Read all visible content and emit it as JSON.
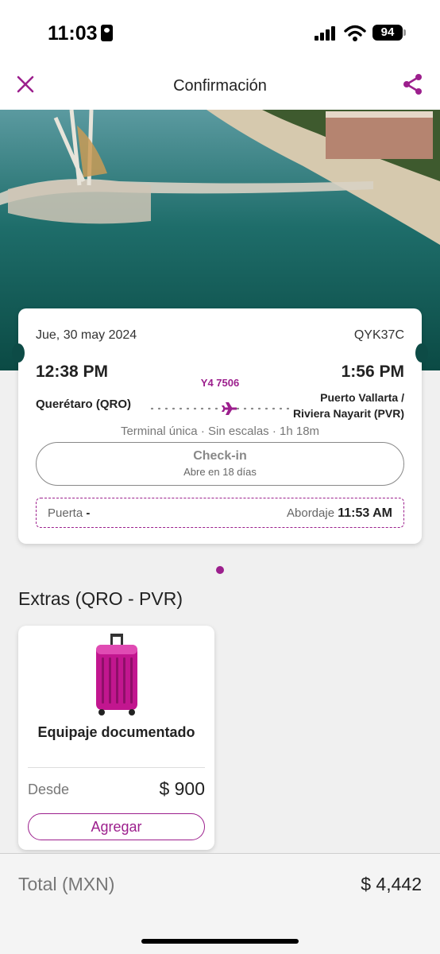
{
  "status_bar": {
    "time": "11:03",
    "battery": "94"
  },
  "header": {
    "title": "Confirmación"
  },
  "flight": {
    "date": "Jue, 30 may 2024",
    "booking_code": "QYK37C",
    "departure_time": "12:38 PM",
    "arrival_time": "1:56 PM",
    "flight_number": "Y4 7506",
    "origin": "Querétaro (QRO)",
    "destination_line1": "Puerto Vallarta /",
    "destination_line2": "Riviera Nayarit (PVR)",
    "meta": "Terminal única · Sin escalas · 1h 18m",
    "checkin_label": "Check-in",
    "checkin_sub": "Abre en 18 días",
    "gate_label": "Puerta",
    "gate_value": "-",
    "boarding_label": "Abordaje",
    "boarding_time": "11:53 AM"
  },
  "extras": {
    "title": "Extras (QRO - PVR)",
    "items": [
      {
        "name": "Equipaje documentado",
        "from_label": "Desde",
        "price": "$ 900",
        "add_label": "Agregar",
        "icon": "luggage-icon"
      }
    ]
  },
  "footer": {
    "total_label": "Total (MXN)",
    "total_value": "$ 4,442"
  },
  "colors": {
    "accent": "#9c1f8d",
    "card": "#ffffff",
    "background": "#f0f0f0"
  }
}
